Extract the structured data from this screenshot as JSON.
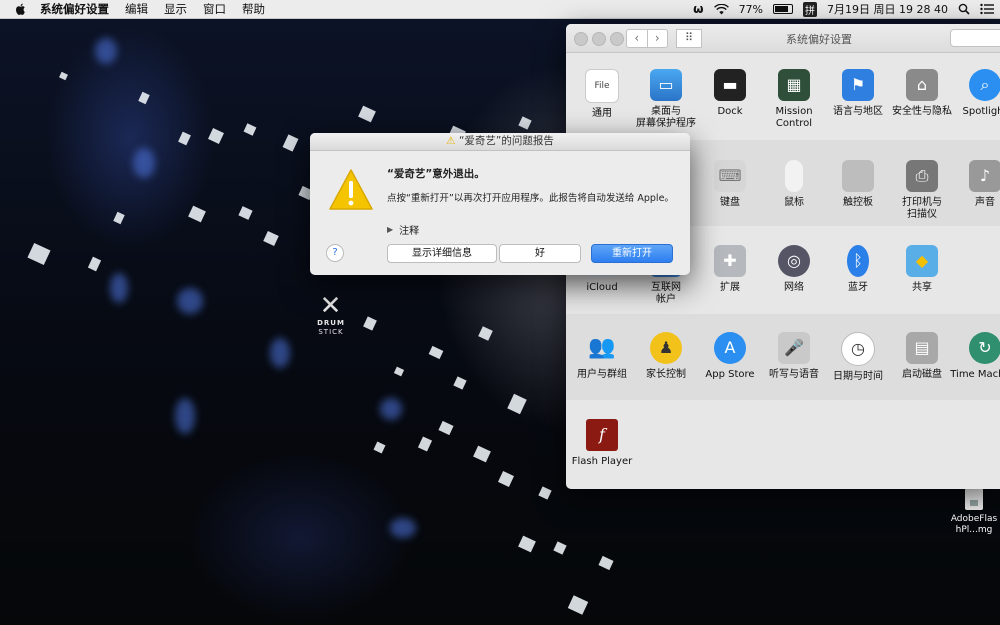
{
  "menubar": {
    "app_name": "系统偏好设置",
    "items": [
      "编辑",
      "显示",
      "窗口",
      "帮助"
    ],
    "battery": "77%",
    "input_method": "拼",
    "clock": "7月19日 周日  19 28 40"
  },
  "desktop": {
    "logo_line1": "DRUM",
    "logo_line2": "STICK",
    "file_label": "AdobeFlashPl...mg"
  },
  "prefs": {
    "title": "系统偏好设置",
    "row1": [
      {
        "label": "通用",
        "icon": "general-icon"
      },
      {
        "label": "桌面与\n屏幕保护程序",
        "icon": "desktop-icon"
      },
      {
        "label": "Dock",
        "icon": "dock-icon"
      },
      {
        "label": "Mission\nControl",
        "icon": "mission-control-icon"
      },
      {
        "label": "语言与地区",
        "icon": "language-icon"
      },
      {
        "label": "安全性与隐私",
        "icon": "security-icon"
      },
      {
        "label": "Spotlight",
        "icon": "spotlight-icon"
      }
    ],
    "row2": [
      {
        "label": "键盘",
        "icon": "keyboard-icon"
      },
      {
        "label": "鼠标",
        "icon": "mouse-icon"
      },
      {
        "label": "触控板",
        "icon": "trackpad-icon"
      },
      {
        "label": "打印机与\n扫描仪",
        "icon": "printer-icon"
      },
      {
        "label": "声音",
        "icon": "sound-icon"
      }
    ],
    "row3": [
      {
        "label": "iCloud",
        "icon": "icloud-icon"
      },
      {
        "label": "互联网\n帐户",
        "icon": "internet-accounts-icon"
      },
      {
        "label": "扩展",
        "icon": "extensions-icon"
      },
      {
        "label": "网络",
        "icon": "network-icon"
      },
      {
        "label": "蓝牙",
        "icon": "bluetooth-icon"
      },
      {
        "label": "共享",
        "icon": "sharing-icon"
      }
    ],
    "row4": [
      {
        "label": "用户与群组",
        "icon": "users-icon"
      },
      {
        "label": "家长控制",
        "icon": "parental-icon"
      },
      {
        "label": "App Store",
        "icon": "appstore-icon"
      },
      {
        "label": "听写与语音",
        "icon": "dictation-icon"
      },
      {
        "label": "日期与时间",
        "icon": "datetime-icon"
      },
      {
        "label": "启动磁盘",
        "icon": "startup-disk-icon"
      },
      {
        "label": "Time Machine",
        "icon": "time-machine-icon"
      }
    ],
    "row5": [
      {
        "label": "Flash Player",
        "icon": "flash-icon"
      }
    ]
  },
  "dialog": {
    "title": "“爱奇艺”的问题报告",
    "heading": "“爱奇艺”意外退出。",
    "message": "点按“重新打开”以再次打开应用程序。此报告将自动发送给 Apple。",
    "notes_label": "注释",
    "help_label": "?",
    "details_button": "显示详细信息",
    "ok_button": "好",
    "reopen_button": "重新打开"
  }
}
